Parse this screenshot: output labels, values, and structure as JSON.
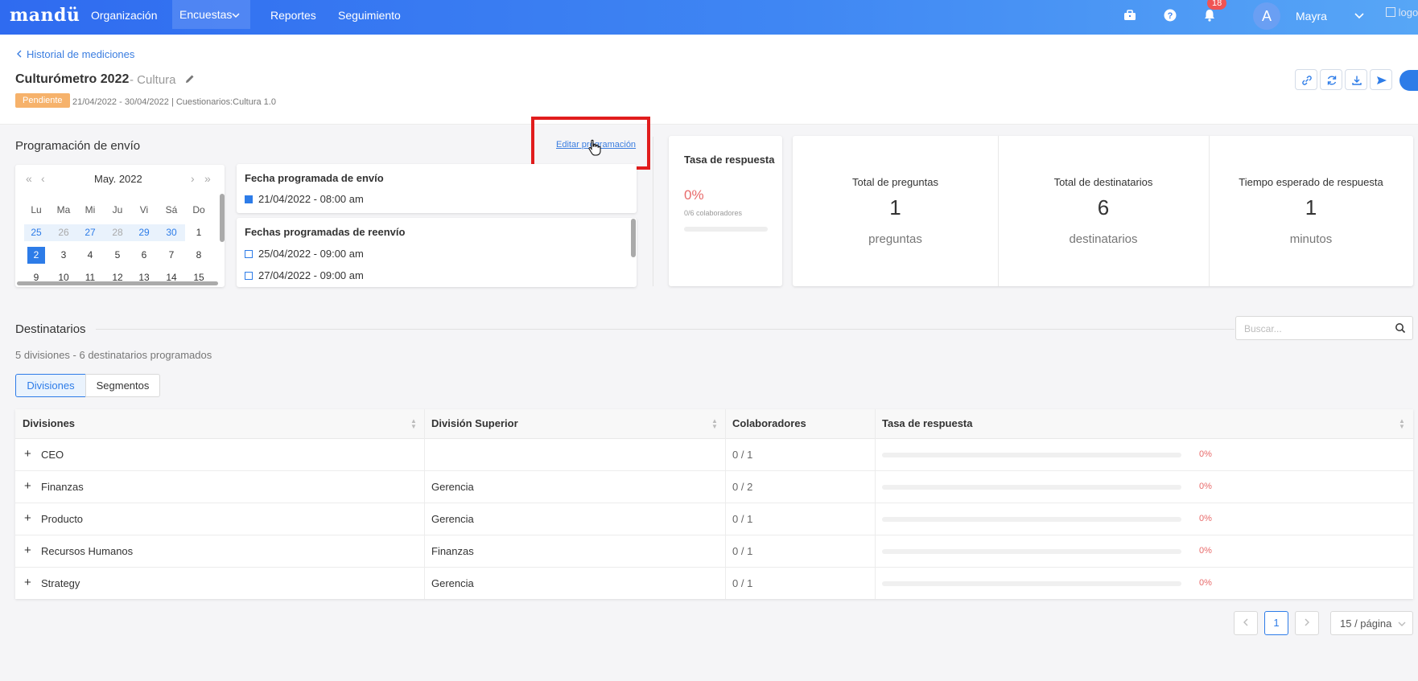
{
  "nav": {
    "brand": "mandü",
    "items": [
      {
        "label": "Organización"
      },
      {
        "label": "Encuestas"
      },
      {
        "label": "Reportes"
      },
      {
        "label": "Seguimiento"
      }
    ],
    "notifications_count": "18",
    "avatar_initial": "A",
    "user_name": "Mayra",
    "logo_alt": "logo"
  },
  "header": {
    "back_label": "Historial de mediciones",
    "title": "Culturómetro 2022",
    "subtitle": "- Cultura",
    "status": "Pendiente",
    "meta": "21/04/2022 - 30/04/2022 | Cuestionarios:Cultura 1.0"
  },
  "schedule": {
    "title": "Programación de envío",
    "edit_label": "Editar programación",
    "calendar": {
      "month_label": "May.  2022",
      "weekdays": [
        "Lu",
        "Ma",
        "Mi",
        "Ju",
        "Vi",
        "Sá",
        "Do"
      ],
      "rows": [
        [
          "25",
          "26",
          "27",
          "28",
          "29",
          "30",
          "1"
        ],
        [
          "2",
          "3",
          "4",
          "5",
          "6",
          "7",
          "8"
        ],
        [
          "9",
          "10",
          "11",
          "12",
          "13",
          "14",
          "15"
        ]
      ],
      "selected_day": "2"
    },
    "send_card": {
      "title": "Fecha programada de envío",
      "dates": [
        "21/04/2022 - 08:00 am"
      ]
    },
    "resend_card": {
      "title": "Fechas programadas de reenvío",
      "dates": [
        "25/04/2022 - 09:00 am",
        "27/04/2022 - 09:00 am"
      ]
    }
  },
  "response_rate": {
    "title": "Tasa de respuesta",
    "value": "0%",
    "detail": "0/6 colaboradores",
    "progress": 0
  },
  "stats": [
    {
      "label": "Total de preguntas",
      "value": "1",
      "unit": "preguntas"
    },
    {
      "label": "Total de destinatarios",
      "value": "6",
      "unit": "destinatarios"
    },
    {
      "label": "Tiempo esperado de respuesta",
      "value": "1",
      "unit": "minutos"
    }
  ],
  "recipients": {
    "title": "Destinatarios",
    "search_placeholder": "Buscar...",
    "summary": "5 divisiones - 6 destinatarios programados",
    "tabs": [
      {
        "label": "Divisiones"
      },
      {
        "label": "Segmentos"
      }
    ],
    "columns": [
      "Divisiones",
      "División Superior",
      "Colaboradores",
      "Tasa de respuesta"
    ],
    "rows": [
      {
        "division": "CEO",
        "parent": "",
        "collaborators": "0 / 1",
        "rate": "0%",
        "progress": 0
      },
      {
        "division": "Finanzas",
        "parent": "Gerencia",
        "collaborators": "0 / 2",
        "rate": "0%",
        "progress": 0
      },
      {
        "division": "Producto",
        "parent": "Gerencia",
        "collaborators": "0 / 1",
        "rate": "0%",
        "progress": 0
      },
      {
        "division": "Recursos Humanos",
        "parent": "Finanzas",
        "collaborators": "0 / 1",
        "rate": "0%",
        "progress": 0
      },
      {
        "division": "Strategy",
        "parent": "Gerencia",
        "collaborators": "0 / 1",
        "rate": "0%",
        "progress": 0
      }
    ]
  },
  "pagination": {
    "current_page": "1",
    "page_size": "15 / página"
  },
  "colors": {
    "primary": "#2d7ce8",
    "warning": "#f6b26b",
    "danger": "#e86a6a",
    "highlight": "#e11d1d"
  }
}
